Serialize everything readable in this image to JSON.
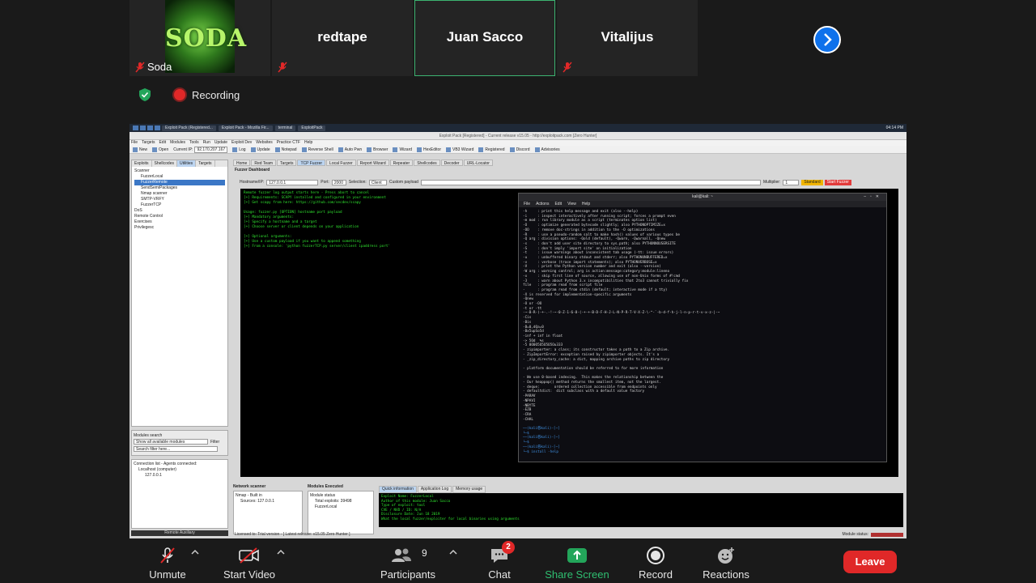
{
  "participants": [
    {
      "name": "Soda",
      "logo_text": "SODA",
      "muted": true
    },
    {
      "name": "redtape",
      "muted": true
    },
    {
      "name": "Juan Sacco",
      "active": true
    },
    {
      "name": "Vitalijus",
      "muted": true
    }
  ],
  "recording_label": "Recording",
  "screen": {
    "taskbar": [
      "Exploit Pack (Registered...",
      "Exploit Pack - Mozilla Fir...",
      "terminal",
      "ExploitPack"
    ],
    "clock": "04:14 PM",
    "window_title": "Exploit Pack [Registered] - Current release v15.05 - http://exploitpack.com [Zero Hunter]",
    "menu": [
      "File",
      "Targets",
      "Edit",
      "Modules",
      "Tools",
      "Run",
      "Update",
      "Exploit Dev",
      "Websites",
      "Practice CTF",
      "Help"
    ],
    "toolbar": [
      "New",
      "Open",
      "Current IP:",
      "Log",
      "Update",
      "Notepad",
      "Reverse Shell",
      "Auto Pwn",
      "Browser",
      "Wizard",
      "HexEditor",
      "VB3 Wizard",
      "Registered",
      "Discord",
      "Advisories"
    ],
    "current_ip": "92.170.207.167",
    "left_tabs": [
      "Exploits",
      "Shellcodes",
      "Utilities",
      "Targets"
    ],
    "tree": [
      "Scanner",
      "FuzzerLocal",
      "FuzzerRemote",
      "SendSemiPackages",
      "Nmap scanner",
      "SMTP-VRFY",
      "FuzzerTCP",
      "DoS",
      "Remote Control",
      "Exercises",
      "Privilegesc"
    ],
    "modules_search_label": "Modules search",
    "modules_select": "Show all available modules",
    "filter_label": "Filter",
    "search_placeholder": "Search filter here...",
    "connection_label": "Connection list - Agents connected:",
    "connections": [
      "Localhost (computer)",
      "127.0.0.1"
    ],
    "remote_label": "Remote Auxiliary",
    "main_tabs": [
      "Home",
      "Red Team",
      "Targets",
      "TCP Fuzzer",
      "Local Fuzzer",
      "Report Wizard",
      "Repeater",
      "Shellcodes",
      "Decoder",
      "URL-Locator"
    ],
    "fuzzer_title": "Fuzzer Dashboard",
    "hostname_label": "Hostname/IP:",
    "hostname": "127.0.0.1",
    "port_label": "Port:",
    "port": "2000",
    "selection_label": "Selection:",
    "selection": "Client",
    "custom_payload_label": "Custom payload",
    "multiplier_label": "Multiplier:",
    "multiplier": "1",
    "stop_label": "Standard",
    "start_label": "Start Fuzzer",
    "fuzz_console": "Remote fuzzer log output starts here - Press abort to cancel\n[+] Requirements: SCAPY installed and configured in your environment\n[+] Get scapy from here: https://github.com/secdev/scapy\n\nUsage: fuzzer.py [OPTION] hostname port payload\n[+] Mandatory arguments:\n[+] Specify a hostname and a target\n[+] Choose server or client depends on your application\n\n[+] Optional arguments:\n[+] Use a custom payload if you want to append something\n[+] From a console: 'python fuzzerTCP.py server/client ipaddress port'",
    "kali_title": "kali@kali: ~",
    "kali_menu": [
      "File",
      "Actions",
      "Edit",
      "View",
      "Help"
    ],
    "kali_output": "-h     : print this help message and exit (also --help)\n-i     : inspect interactively after running script; forces a prompt even\n-m mod : run library module as a script (terminates option list)\n-O     : optimize generated bytecode slightly; also PYTHONOPTIMIZE=x\n-OO    : remove doc-strings in addition to the -O optimizations\n-R     : use a pseudo-random salt to make hash() values of various types be\n-Q arg : division options: -Qold (default), -Qwarn, -Qwarnall, -Qnew\n-s     : don't add user site directory to sys.path; also PYTHONNOUSERSITE\n-S     : don't imply 'import site' on initialization\n-t     : issue warnings about inconsistent tab usage (-tt: issue errors)\n-u     : unbuffered binary stdout and stderr; also PYTHONUNBUFFERED=x\n-v     : verbose (trace import statements); also PYTHONVERBOSE=x\n-V     : print the Python version number and exit (also --version)\n-W arg : warning control; arg is action:message:category:module:lineno\n-x     : skip first line of source, allowing use of non-Unix forms of #!cmd\n-3     : warn about Python 3.x incompatibilities that 2to3 cannot trivially fix\nfile   : program read from script file\n-      : program read from stdin (default; interactive mode if a tty)\n-X is reserved for implementation-specific arguments\n-Qnew\n-O or -OO\n-t or -tt\n-~-B-R-(-+-.-!-~-0-Z-1-6-8-(-+-+-B-D-F-H-J-L-N-P-R-T-V-X-Z-\\-^-`-b-d-f-h-j-l-n-p-r-t-v-x-z-|-~\n-Cis\n-Bis\n-B=0,dQa=0\n-Bx5upSo5d\n-inf + inf in float\n-> 5Od  %s\n-5 0O0O5O5O5O5Ou333\n- zipimporter: a class; its constructor takes a path to a Zip archive.\n- ZipImportError: exception raised by zipimporter objects. It's a\n- _zip_directory_cache: a dict, mapping archive paths to zip directory\n\n- platform documentation should be referred to for more information\n\n- We use 0-based indexing.  This makes the relationship between the\n- Our heappop() method returns the smallest item, not the largest.\n- deque:       ordered collection accessible from endpoints only\n- defaultdict:  dict subclass with a default value factory\n-PARAV\n-NPAVI\n-NBYTE\n-EZB\n-CRA\n-CHAL\n\n",
    "kali_prompts": [
      "──(kali㉿kali)-[~]\n└─$ ",
      "──(kali㉿kali)-[~]\n└─$ ",
      "──(kali㉿kali)-[~]\n└─$ install -help"
    ],
    "network_scanner_label": "Network scanner",
    "network_items": [
      "Nmap - Built in",
      "Sources: 127.0.0.1"
    ],
    "modules_executed_label": "Modules Executed",
    "executed_items": [
      "Module status",
      "Total exploits: 39498",
      "FuzzerLocal"
    ],
    "log_tabs": [
      "Quick information",
      "Application Log",
      "Memory usage"
    ],
    "log_text": "Exploit Name: FuzzerLocal\nAuthor of this module: Juan Sacco\nType of exploit: tool\nCVE / NVD / ID: N/A\nDisclosure Date: Jun 18 2019\nWhat the local fuzzer/exploiter for local binaries using arguments",
    "status_text": "Licensed to: Trial version - [ Latest release: v15.05 Zero Hunter ]",
    "module_status_label": "Module status:"
  },
  "toolbar": {
    "unmute": "Unmute",
    "start_video": "Start Video",
    "participants": "Participants",
    "participants_count": "9",
    "chat": "Chat",
    "chat_badge": "2",
    "share_screen": "Share Screen",
    "record": "Record",
    "reactions": "Reactions",
    "leave": "Leave"
  },
  "colors": {
    "share_green": "#2fbf71",
    "leave_red": "#e02828",
    "record_red": "#e02828",
    "accent_blue": "#0e71eb"
  }
}
